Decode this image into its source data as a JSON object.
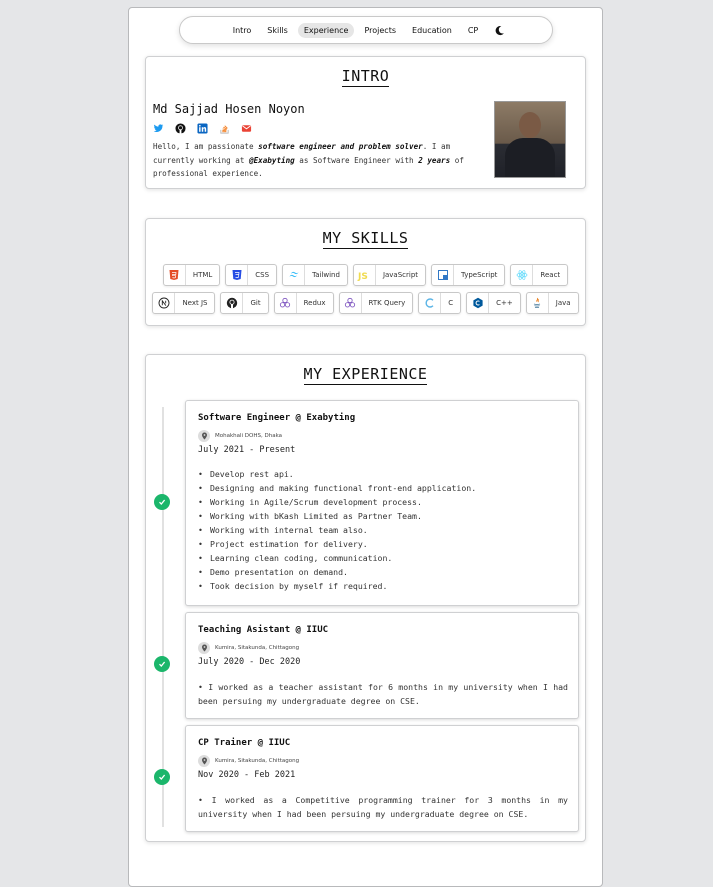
{
  "nav": {
    "items": [
      "Intro",
      "Skills",
      "Experience",
      "Projects",
      "Education",
      "CP"
    ],
    "active": "Experience",
    "theme_icon": "moon-icon"
  },
  "intro": {
    "title": "INTRO",
    "name": "Md Sajjad Hosen Noyon",
    "social_icons": [
      "twitter-icon",
      "github-icon",
      "linkedin-icon",
      "stackoverflow-icon",
      "mail-icon"
    ],
    "bio": {
      "p1": "Hello, I am passionate ",
      "b1": "software engineer and problem solver",
      "p2": ". I am currently working at ",
      "b2": "@Exabyting",
      "p3": " as Software Engineer with ",
      "b3": "2 years",
      "p4": " of professional experience."
    }
  },
  "skills": {
    "title": "MY SKILLS",
    "row1": [
      {
        "label": "HTML",
        "icon": "html5-icon",
        "color": "#e44d26"
      },
      {
        "label": "CSS",
        "icon": "css3-icon",
        "color": "#264de4"
      },
      {
        "label": "Tailwind",
        "icon": "tailwind-icon",
        "color": "#38bdf8"
      },
      {
        "label": "JavaScript",
        "icon": "javascript-icon",
        "color": "#f0db4f"
      },
      {
        "label": "TypeScript",
        "icon": "typescript-icon",
        "color": "#3178c6"
      },
      {
        "label": "React",
        "icon": "react-icon",
        "color": "#61dafb"
      }
    ],
    "row2": [
      {
        "label": "Next JS",
        "icon": "nextjs-icon",
        "color": "#222222"
      },
      {
        "label": "Git",
        "icon": "github-icon",
        "color": "#222222"
      },
      {
        "label": "Redux",
        "icon": "redux-icon",
        "color": "#764abc"
      },
      {
        "label": "RTK Query",
        "icon": "redux-icon",
        "color": "#764abc"
      },
      {
        "label": "C",
        "icon": "c-icon",
        "color": "#5ab4e6"
      },
      {
        "label": "C++",
        "icon": "cplusplus-icon",
        "color": "#00599c"
      },
      {
        "label": "Java",
        "icon": "java-icon",
        "color": "#e76f00"
      }
    ]
  },
  "experience": {
    "title": "MY EXPERIENCE",
    "accent": "#1bb66b",
    "jobs": [
      {
        "title": "Software Engineer @ Exabyting",
        "location": "Mohakhali DOHS, Dhaka",
        "dates": "July 2021 - Present",
        "duties": [
          "Develop rest api.",
          "Designing and making functional front-end application.",
          "Working in Agile/Scrum development process.",
          "Working with bKash Limited as Partner Team.",
          "Working with internal team also.",
          "Project estimation for delivery.",
          "Learning clean coding, communication.",
          "Demo presentation on demand.",
          "Took decision by myself if required."
        ]
      },
      {
        "title": "Teaching Asistant @ IIUC",
        "location": "Kumira, Sitakunda, Chittagong",
        "dates": "July 2020 - Dec 2020",
        "description": "• I worked as a teacher assistant for 6 months in my university when I had been persuing my undergraduate degree on CSE."
      },
      {
        "title": "CP Trainer @ IIUC",
        "location": "Kumira, Sitakunda, Chittagong",
        "dates": "Nov 2020 - Feb 2021",
        "description": "• I worked as a Competitive programming trainer for 3 months in my university when I had been persuing my undergraduate degree on CSE."
      }
    ]
  }
}
